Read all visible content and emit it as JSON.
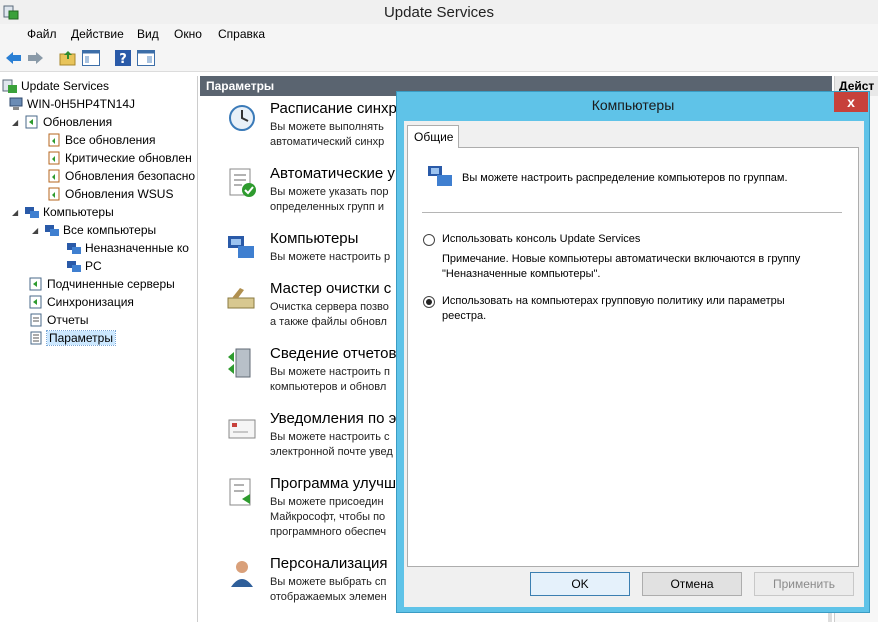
{
  "window": {
    "title": "Update Services"
  },
  "menu": [
    "Файл",
    "Действие",
    "Вид",
    "Окно",
    "Справка"
  ],
  "tree": {
    "root": "Update Services",
    "server": "WIN-0H5HP4TN14J",
    "updates": "Обновления",
    "all_updates": "Все обновления",
    "critical": "Критические обновлен",
    "security": "Обновления безопасно",
    "wsus": "Обновления WSUS",
    "computers": "Компьютеры",
    "all_computers": "Все компьютеры",
    "unassigned": "Неназначенные ко",
    "pc": "PC",
    "downstream": "Подчиненные серверы",
    "sync": "Синхронизация",
    "reports": "Отчеты",
    "options": "Параметры"
  },
  "center": {
    "header": "Параметры",
    "items": [
      {
        "title": "Расписание синхр",
        "desc1": "Вы можете выполнять",
        "desc2": "автоматический синхр"
      },
      {
        "title": "Автоматические у",
        "desc1": "Вы можете указать пор",
        "desc2": "определенных групп и"
      },
      {
        "title": "Компьютеры",
        "desc1": "Вы можете настроить р",
        "desc2": ""
      },
      {
        "title": "Мастер очистки с",
        "desc1": "Очистка сервера позво",
        "desc2": "а также файлы обновл"
      },
      {
        "title": "Сведение отчетов",
        "desc1": "Вы можете настроить п",
        "desc2": "компьютеров и обновл"
      },
      {
        "title": "Уведомления по э",
        "desc1": "Вы можете настроить с",
        "desc2": "электронной почте увед"
      },
      {
        "title": "Программа улучш",
        "desc1": "Вы можете присоедин",
        "desc2": "Майкрософт, чтобы по",
        "desc3": "программного обеспеч"
      },
      {
        "title": "Персонализация",
        "desc1": "Вы можете выбрать сп",
        "desc2": "отображаемых элемен"
      }
    ]
  },
  "actions": {
    "header": "Дейст"
  },
  "dialog": {
    "title": "Компьютеры",
    "close": "x",
    "tab": "Общие",
    "intro": "Вы можете настроить распределение компьютеров по группам.",
    "option1": "Использовать консоль Update Services",
    "note1": "Примечание. Новые компьютеры автоматически включаются в группу",
    "note2": "\"Неназначенные компьютеры\".",
    "option2_line1": "Использовать на компьютерах групповую политику или параметры",
    "option2_line2": "реестра.",
    "selected_option": 2,
    "ok": "OK",
    "cancel": "Отмена",
    "apply": "Применить"
  }
}
